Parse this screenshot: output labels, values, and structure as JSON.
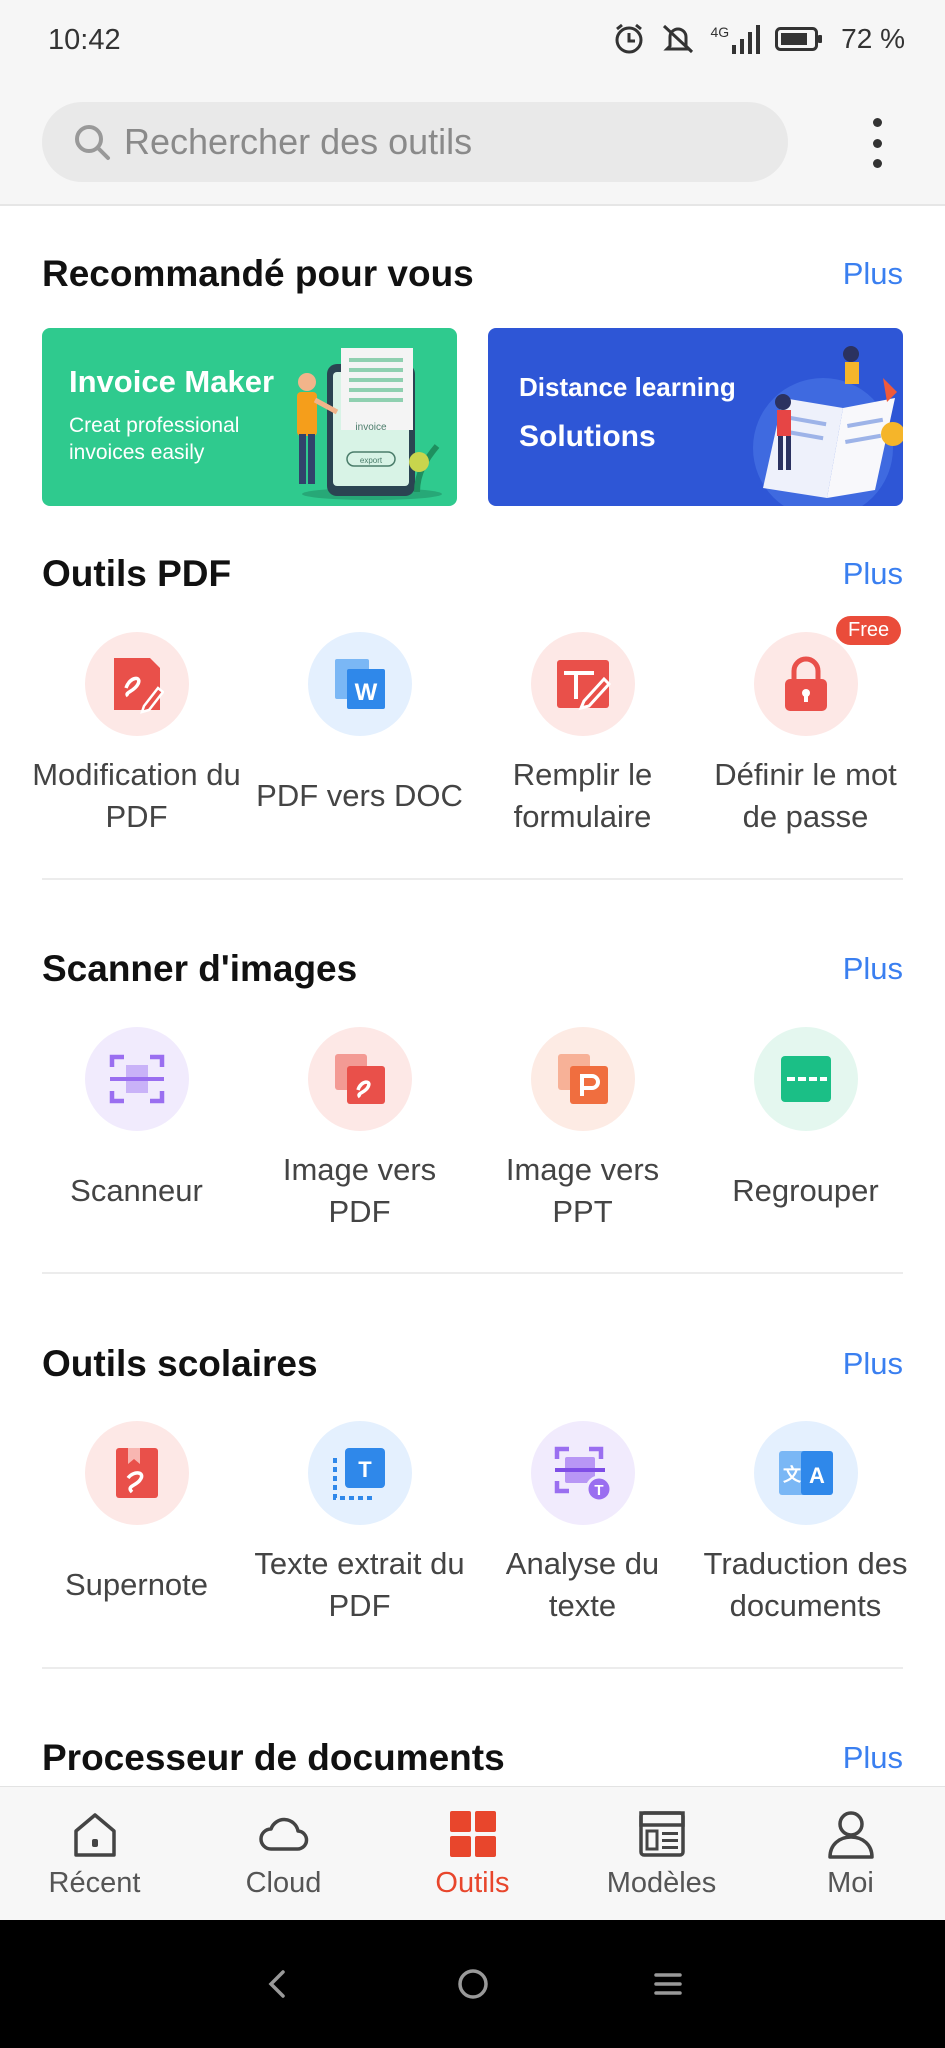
{
  "status": {
    "time": "10:42",
    "network": "4G",
    "battery": "72 %"
  },
  "search": {
    "placeholder": "Rechercher des outils"
  },
  "sections": {
    "recommended": {
      "title": "Recommandé pour vous",
      "more": "Plus"
    },
    "pdf": {
      "title": "Outils PDF",
      "more": "Plus"
    },
    "scanner": {
      "title": "Scanner d'images",
      "more": "Plus"
    },
    "school": {
      "title": "Outils scolaires",
      "more": "Plus"
    },
    "processor": {
      "title": "Processeur de documents",
      "more": "Plus"
    }
  },
  "banners": {
    "invoice": {
      "title": "Invoice Maker",
      "subtitle_1": "Creat professional",
      "subtitle_2": "invoices easily",
      "doc_label": "invoice",
      "button_label": "export"
    },
    "distance": {
      "title_1": "Distance learning",
      "title_2": "Solutions"
    }
  },
  "pdf_tools": [
    {
      "label": "Modification du PDF",
      "icon": "pdf-edit-icon"
    },
    {
      "label": "PDF vers DOC",
      "icon": "pdf-to-word-icon"
    },
    {
      "label": "Remplir le formulaire",
      "icon": "form-fill-icon"
    },
    {
      "label": "Définir le mot de passe",
      "icon": "lock-icon",
      "badge": "Free"
    }
  ],
  "scanner_tools": [
    {
      "label": "Scanneur",
      "icon": "scan-icon"
    },
    {
      "label": "Image vers PDF",
      "icon": "image-to-pdf-icon"
    },
    {
      "label": "Image vers PPT",
      "icon": "image-to-ppt-icon"
    },
    {
      "label": "Regrouper",
      "icon": "merge-icon"
    }
  ],
  "school_tools": [
    {
      "label": "Supernote",
      "icon": "supernote-icon"
    },
    {
      "label": "Texte extrait du PDF",
      "icon": "extract-text-icon"
    },
    {
      "label": "Analyse du texte",
      "icon": "text-analysis-icon"
    },
    {
      "label": "Traduction des documents",
      "icon": "translate-icon"
    }
  ],
  "nav": {
    "recent": "Récent",
    "cloud": "Cloud",
    "tools": "Outils",
    "templates": "Modèles",
    "me": "Moi"
  },
  "colors": {
    "accent": "#e8462c",
    "link": "#3a7ff0",
    "invoice_banner": "#2fca8e",
    "distance_banner": "#2e56d6"
  }
}
